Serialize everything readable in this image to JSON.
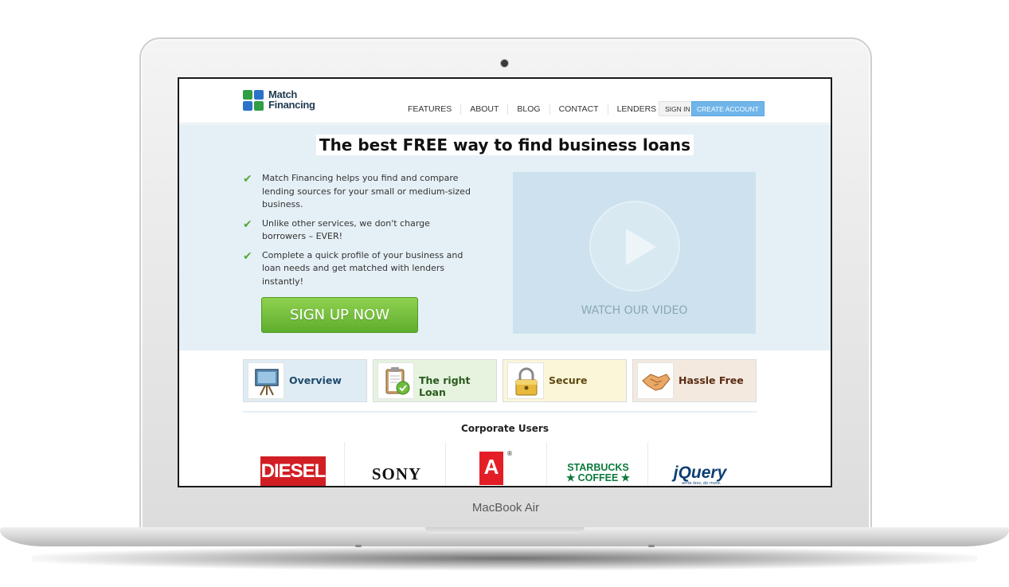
{
  "device": {
    "brand_label": "MacBook Air"
  },
  "header": {
    "logo_line1": "Match",
    "logo_line2": "Financing",
    "nav": [
      "FEATURES",
      "ABOUT",
      "BLOG",
      "CONTACT",
      "LENDERS"
    ],
    "sign_in": "SIGN IN",
    "create_account": "CREATE ACCOUNT"
  },
  "hero": {
    "headline": "The best FREE way to find business loans",
    "bullets": [
      "Match Financing helps you find and compare lending sources for your small or medium-sized business.",
      "Unlike other services, we don't charge borrowers – EVER!",
      "Complete a quick profile of your business and loan needs and get matched with lenders instantly!"
    ],
    "cta": "SIGN UP NOW",
    "video_label": "WATCH OUR VIDEO"
  },
  "features": [
    {
      "label": "Overview",
      "icon": "easel-icon"
    },
    {
      "label": "The right Loan",
      "icon": "clipboard-check-icon"
    },
    {
      "label": "Secure",
      "icon": "padlock-icon"
    },
    {
      "label": "Hassle Free",
      "icon": "handshake-icon"
    }
  ],
  "corporate": {
    "title": "Corporate Users",
    "logos": [
      "DIESEL",
      "SONY",
      "Adobe",
      "STARBUCKS COFFEE",
      "jQuery"
    ],
    "diesel_text": "DIESEL",
    "sony_text": "SONY",
    "adobe_text": "A",
    "starbucks_line1": "STARBUCKS",
    "starbucks_line2": "★ COFFEE ★",
    "jquery_text": "jQuery",
    "jquery_tagline": "write less, do more."
  }
}
